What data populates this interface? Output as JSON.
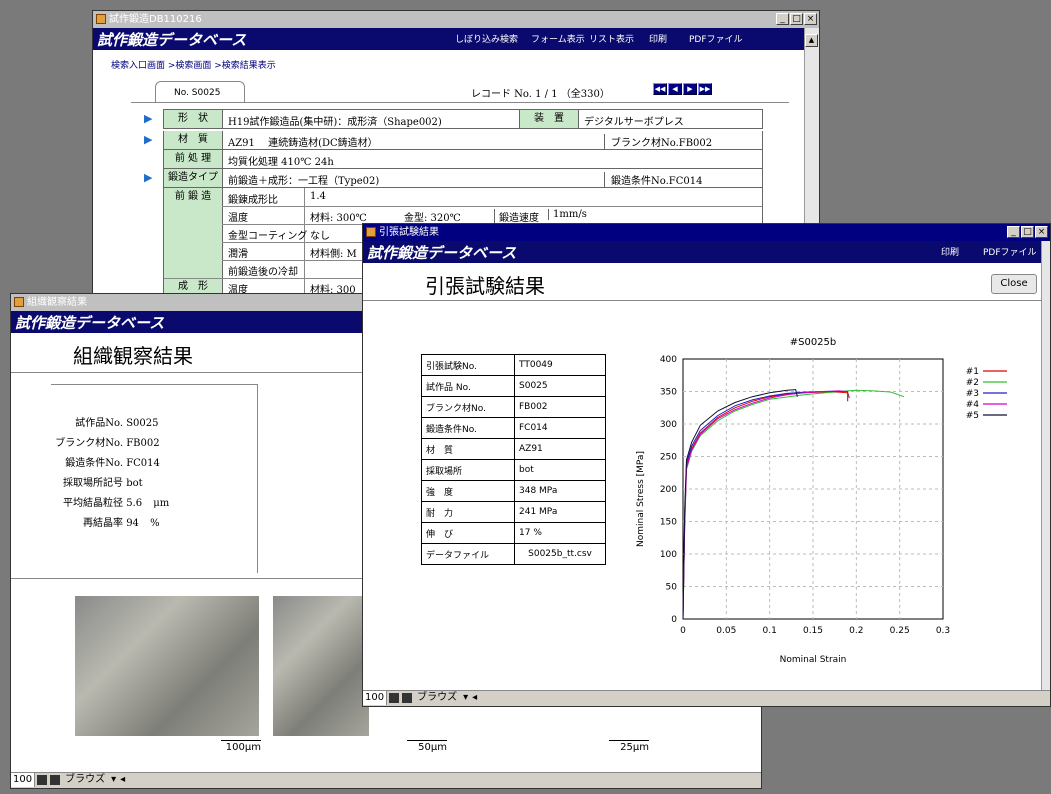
{
  "bg_color": "#7a7a7a",
  "accent_color": "#0a0a6e",
  "main_window": {
    "title": "試作鍛造DB110216",
    "app_header": "試作鍛造データベース",
    "menu": [
      "しぼり込み検索",
      "フォーム表示",
      "リスト表示",
      "印刷",
      "PDFファイル"
    ],
    "breadcrumb": "検索入口画面 >検索画面 >検索結果表示",
    "tab_label": "No. S0025",
    "record": "レコード No. 1 / 1 （全330）",
    "rows": [
      {
        "label": "形　状",
        "value": "H19試作鍛造品(集中研)：成形済（Shape002)",
        "label2": "装　置",
        "value2": "デジタルサーボプレス",
        "marker": true
      },
      {
        "label": "材　質",
        "value": "AZ91　 連続鋳造材(DC鋳造材）",
        "extra": "ブランク材No.FB002",
        "marker": true
      },
      {
        "label": "前 処 理",
        "value": "均質化処理 410℃ 24h"
      },
      {
        "label": "鍛造タイプ",
        "value": "前鍛造＋成形：一工程（Type02)",
        "extra": "鍛造条件No.FC014",
        "marker": true
      },
      {
        "label": "前 鍛 造",
        "value": "鍛錬成形比",
        "v2": "1.4"
      },
      {
        "label": "",
        "value": "温度",
        "v2": "材料: 300℃",
        "v3": "金型: 320℃",
        "v4": "鍛造速度",
        "v5": "1mm/s"
      },
      {
        "label": "",
        "value": "金型コーティング",
        "v2": "なし"
      },
      {
        "label": "",
        "value": "潤滑",
        "v2": "材料側: M"
      },
      {
        "label": "",
        "value": "前鍛造後の冷却",
        "v2": ""
      },
      {
        "label": "成　形",
        "value": "温度",
        "v2": "材料: 300"
      }
    ]
  },
  "micro_window": {
    "title": "組織観察結果",
    "app_header": "試作鍛造データベース",
    "heading": "組織観察結果",
    "fields": [
      {
        "label": "試作品No.",
        "value": "S0025"
      },
      {
        "label": "ブランク材No.",
        "value": "FB002"
      },
      {
        "label": "鍛造条件No.",
        "value": "FC014"
      },
      {
        "label": "採取場所記号",
        "value": "bot"
      },
      {
        "label": "平均結晶粒径",
        "value": "5.6",
        "unit": "μm"
      },
      {
        "label": "再結晶率",
        "value": "94",
        "unit": "%"
      }
    ],
    "scales": [
      "100μm",
      "50μm",
      "25μm"
    ],
    "status": {
      "zoom": "100",
      "mode": "ブラウズ"
    }
  },
  "tensile_window": {
    "title": "引張試験結果",
    "app_header": "試作鍛造データベース",
    "menu": [
      "印刷",
      "PDFファイル"
    ],
    "heading": "引張試験結果",
    "close_label": "Close",
    "table": [
      {
        "label": "引張試験No.",
        "value": "TT0049"
      },
      {
        "label": "試作品 No.",
        "value": "S0025"
      },
      {
        "label": "ブランク材No.",
        "value": "FB002"
      },
      {
        "label": "鍛造条件No.",
        "value": "FC014"
      },
      {
        "label": "材　質",
        "value": "AZ91"
      },
      {
        "label": "採取場所",
        "value": "bot"
      },
      {
        "label": "強　度",
        "value": "348 MPa"
      },
      {
        "label": "耐　力",
        "value": "241 MPa"
      },
      {
        "label": "伸　び",
        "value": "17 %"
      },
      {
        "label": "データファイル",
        "value": "S0025b_tt.csv"
      }
    ],
    "status": {
      "zoom": "100",
      "mode": "ブラウズ"
    }
  },
  "chart_data": {
    "type": "line",
    "title": "#S0025b",
    "xlabel": "Nominal Strain",
    "ylabel": "Nominal Stress [MPa]",
    "xlim": [
      0,
      0.3
    ],
    "ylim": [
      0,
      400
    ],
    "xticks": [
      0,
      0.05,
      0.1,
      0.15,
      0.2,
      0.25,
      0.3
    ],
    "yticks": [
      0,
      50,
      100,
      150,
      200,
      250,
      300,
      350,
      400
    ],
    "grid": true,
    "legend_position": "right",
    "series": [
      {
        "name": "#1",
        "color": "#e00000",
        "x": [
          0,
          0.002,
          0.004,
          0.01,
          0.02,
          0.04,
          0.06,
          0.08,
          0.1,
          0.12,
          0.14,
          0.16,
          0.18,
          0.19,
          0.192
        ],
        "y": [
          0,
          150,
          235,
          262,
          286,
          310,
          325,
          335,
          342,
          346,
          348,
          349,
          349,
          348,
          340
        ]
      },
      {
        "name": "#2",
        "color": "#30c030",
        "x": [
          0,
          0.002,
          0.004,
          0.01,
          0.02,
          0.04,
          0.06,
          0.08,
          0.1,
          0.14,
          0.18,
          0.2,
          0.22,
          0.24,
          0.255
        ],
        "y": [
          0,
          140,
          230,
          258,
          282,
          305,
          320,
          330,
          338,
          345,
          350,
          352,
          351,
          349,
          342
        ]
      },
      {
        "name": "#3",
        "color": "#2020c0",
        "x": [
          0,
          0.002,
          0.004,
          0.01,
          0.02,
          0.04,
          0.06,
          0.08,
          0.1,
          0.12,
          0.14,
          0.16,
          0.18,
          0.19,
          0.19
        ],
        "y": [
          0,
          160,
          240,
          266,
          290,
          313,
          328,
          337,
          343,
          347,
          349,
          350,
          350,
          350,
          335
        ]
      },
      {
        "name": "#4",
        "color": "#d000d0",
        "x": [
          0,
          0.002,
          0.004,
          0.01,
          0.02,
          0.04,
          0.06,
          0.08,
          0.1,
          0.12,
          0.14,
          0.16,
          0.18,
          0.19
        ],
        "y": [
          0,
          145,
          232,
          260,
          284,
          308,
          322,
          332,
          340,
          345,
          348,
          350,
          351,
          350
        ]
      },
      {
        "name": "#5",
        "color": "#101030",
        "x": [
          0,
          0.002,
          0.004,
          0.01,
          0.02,
          0.04,
          0.06,
          0.08,
          0.1,
          0.12,
          0.13,
          0.132
        ],
        "y": [
          0,
          170,
          245,
          272,
          298,
          320,
          333,
          342,
          348,
          352,
          353,
          342
        ]
      }
    ]
  }
}
